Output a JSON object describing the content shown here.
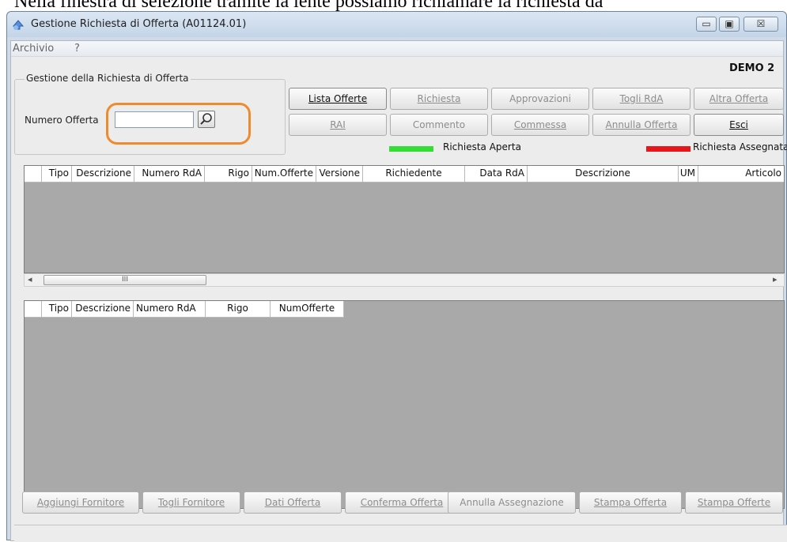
{
  "document_caption": "Nella finestra di selezione tramite la lente possiamo richiamare la richiesta da",
  "window": {
    "title": "Gestione Richiesta di Offerta (A01124.01)"
  },
  "window_controls": {
    "minimize": "▭",
    "maximize": "▣",
    "close": "☒"
  },
  "menu": [
    "Archivio",
    "?"
  ],
  "company": "DEMO 2",
  "group": {
    "title": "Gestione della Richiesta di Offerta",
    "numero_label": "Numero Offerta",
    "numero_value": ""
  },
  "toolbar": {
    "row1": [
      "Lista Offerte",
      "Richiesta",
      "Approvazioni",
      "Togli RdA",
      "Altra Offerta"
    ],
    "row2": [
      "RAI",
      "Commento",
      "Commessa",
      "Annulla Offerta",
      "Esci"
    ]
  },
  "legend": [
    {
      "label": "Richiesta Aperta",
      "color": "#33dd33"
    },
    {
      "label": "Richiesta Assegnata",
      "color": "#e8151b"
    }
  ],
  "grid_top": {
    "columns": [
      "",
      "Tipo",
      "Descrizione",
      "Numero RdA",
      "Rigo",
      "Num.Offerte",
      "Versione",
      "Richiedente",
      "Data RdA",
      "Descrizione",
      "UM",
      "Articolo"
    ]
  },
  "scrollbar": {
    "left_arrow": "◂",
    "right_arrow": "▸",
    "grip": "III"
  },
  "grid_bottom": {
    "columns": [
      "",
      "Tipo",
      "Descrizione",
      "Numero RdA",
      "Rigo",
      "NumOfferte"
    ]
  },
  "bottom_buttons": [
    "Aggiungi Fornitore",
    "Togli Fornitore",
    "Dati Offerta",
    "Conferma Offerta",
    "Annulla Assegnazione",
    "Stampa Offerta",
    "Stampa Offerte"
  ],
  "colors": {
    "highlight": "#f08a2e",
    "grid_bg": "#a9a9a9"
  }
}
